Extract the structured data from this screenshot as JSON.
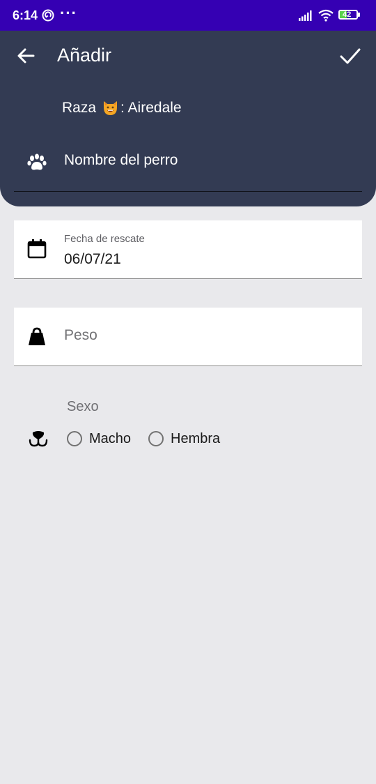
{
  "status_bar": {
    "time": "6:14",
    "more": "···",
    "battery_level": "42",
    "battery_color": "#5ad34b"
  },
  "header": {
    "title": "Añadir",
    "back_icon": "arrow-left-icon",
    "confirm_icon": "check-icon",
    "breed_prefix": "Raza",
    "breed_emoji": "grinning-cat-emoji",
    "breed_value": ": Airedale",
    "name_placeholder": "Nombre del perro",
    "background": "#333b53"
  },
  "form": {
    "rescue_date": {
      "label": "Fecha de rescate",
      "value": "06/07/21",
      "icon": "calendar-icon"
    },
    "weight": {
      "placeholder": "Peso",
      "icon": "weight-icon"
    },
    "sex": {
      "label": "Sexo",
      "icon": "dog-nose-icon",
      "options": [
        {
          "label": "Macho",
          "selected": false
        },
        {
          "label": "Hembra",
          "selected": false
        }
      ]
    }
  },
  "colors": {
    "status_bar": "#3500b3",
    "page_background": "#e9e9ec"
  }
}
